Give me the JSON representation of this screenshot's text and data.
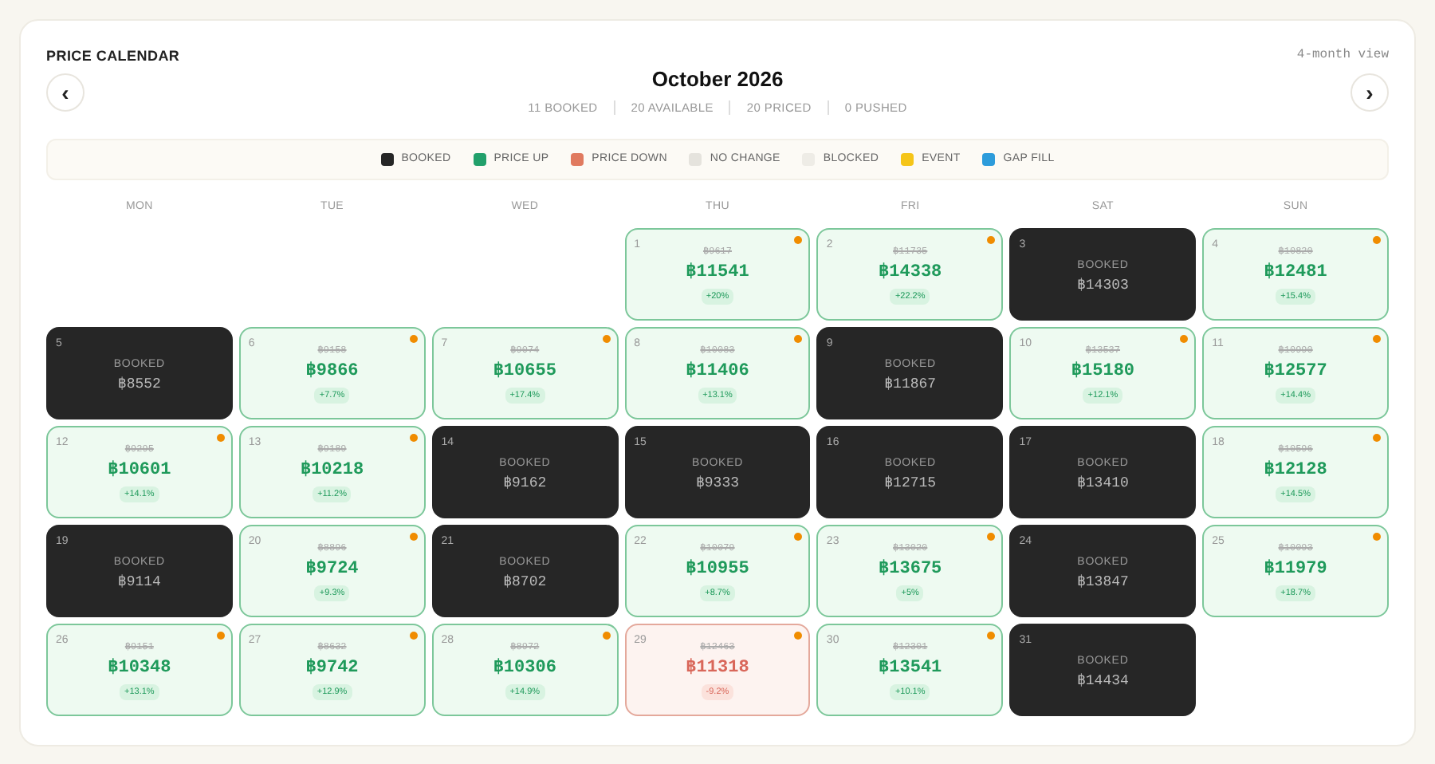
{
  "header": {
    "title": "PRICE CALENDAR",
    "view": "4-month view",
    "month": "October 2026",
    "prev_icon": "‹",
    "next_icon": "›"
  },
  "stats": [
    "11 BOOKED",
    "20 AVAILABLE",
    "20 PRICED",
    "0 PUSHED"
  ],
  "legend": [
    {
      "label": "BOOKED",
      "color": "#262626"
    },
    {
      "label": "PRICE UP",
      "color": "#22a06b"
    },
    {
      "label": "PRICE DOWN",
      "color": "#e07a5f"
    },
    {
      "label": "NO CHANGE",
      "color": "#e5e3dd"
    },
    {
      "label": "BLOCKED",
      "color": "#eeece6"
    },
    {
      "label": "EVENT",
      "color": "#f5c518"
    },
    {
      "label": "GAP FILL",
      "color": "#2d9cdb"
    }
  ],
  "weekdays": [
    "MON",
    "TUE",
    "WED",
    "THU",
    "FRI",
    "SAT",
    "SUN"
  ],
  "weeks": [
    [
      {
        "kind": "empty"
      },
      {
        "kind": "empty"
      },
      {
        "kind": "empty"
      },
      {
        "day": "1",
        "kind": "up",
        "old_price": "฿9617",
        "price": "฿11541",
        "change": "+20%",
        "flag": true
      },
      {
        "day": "2",
        "kind": "up",
        "old_price": "฿11735",
        "price": "฿14338",
        "change": "+22.2%",
        "flag": true
      },
      {
        "day": "3",
        "kind": "booked",
        "label": "BOOKED",
        "price": "฿14303"
      },
      {
        "day": "4",
        "kind": "up",
        "old_price": "฿10820",
        "price": "฿12481",
        "change": "+15.4%",
        "flag": true
      }
    ],
    [
      {
        "day": "5",
        "kind": "booked",
        "label": "BOOKED",
        "price": "฿8552"
      },
      {
        "day": "6",
        "kind": "up",
        "old_price": "฿9158",
        "price": "฿9866",
        "change": "+7.7%",
        "flag": true
      },
      {
        "day": "7",
        "kind": "up",
        "old_price": "฿9074",
        "price": "฿10655",
        "change": "+17.4%",
        "flag": true
      },
      {
        "day": "8",
        "kind": "up",
        "old_price": "฿10083",
        "price": "฿11406",
        "change": "+13.1%",
        "flag": true
      },
      {
        "day": "9",
        "kind": "booked",
        "label": "BOOKED",
        "price": "฿11867"
      },
      {
        "day": "10",
        "kind": "up",
        "old_price": "฿13537",
        "price": "฿15180",
        "change": "+12.1%",
        "flag": true
      },
      {
        "day": "11",
        "kind": "up",
        "old_price": "฿10990",
        "price": "฿12577",
        "change": "+14.4%",
        "flag": true
      }
    ],
    [
      {
        "day": "12",
        "kind": "up",
        "old_price": "฿9295",
        "price": "฿10601",
        "change": "+14.1%",
        "flag": true
      },
      {
        "day": "13",
        "kind": "up",
        "old_price": "฿9189",
        "price": "฿10218",
        "change": "+11.2%",
        "flag": true
      },
      {
        "day": "14",
        "kind": "booked",
        "label": "BOOKED",
        "price": "฿9162"
      },
      {
        "day": "15",
        "kind": "booked",
        "label": "BOOKED",
        "price": "฿9333"
      },
      {
        "day": "16",
        "kind": "booked",
        "label": "BOOKED",
        "price": "฿12715"
      },
      {
        "day": "17",
        "kind": "booked",
        "label": "BOOKED",
        "price": "฿13410"
      },
      {
        "day": "18",
        "kind": "up",
        "old_price": "฿10596",
        "price": "฿12128",
        "change": "+14.5%",
        "flag": true
      }
    ],
    [
      {
        "day": "19",
        "kind": "booked",
        "label": "BOOKED",
        "price": "฿9114"
      },
      {
        "day": "20",
        "kind": "up",
        "old_price": "฿8896",
        "price": "฿9724",
        "change": "+9.3%",
        "flag": true
      },
      {
        "day": "21",
        "kind": "booked",
        "label": "BOOKED",
        "price": "฿8702"
      },
      {
        "day": "22",
        "kind": "up",
        "old_price": "฿10079",
        "price": "฿10955",
        "change": "+8.7%",
        "flag": true
      },
      {
        "day": "23",
        "kind": "up",
        "old_price": "฿13020",
        "price": "฿13675",
        "change": "+5%",
        "flag": true
      },
      {
        "day": "24",
        "kind": "booked",
        "label": "BOOKED",
        "price": "฿13847"
      },
      {
        "day": "25",
        "kind": "up",
        "old_price": "฿10093",
        "price": "฿11979",
        "change": "+18.7%",
        "flag": true
      }
    ],
    [
      {
        "day": "26",
        "kind": "up",
        "old_price": "฿9151",
        "price": "฿10348",
        "change": "+13.1%",
        "flag": true
      },
      {
        "day": "27",
        "kind": "up",
        "old_price": "฿8632",
        "price": "฿9742",
        "change": "+12.9%",
        "flag": true
      },
      {
        "day": "28",
        "kind": "up",
        "old_price": "฿8972",
        "price": "฿10306",
        "change": "+14.9%",
        "flag": true
      },
      {
        "day": "29",
        "kind": "down",
        "old_price": "฿12463",
        "price": "฿11318",
        "change": "-9.2%",
        "flag": true
      },
      {
        "day": "30",
        "kind": "up",
        "old_price": "฿12301",
        "price": "฿13541",
        "change": "+10.1%",
        "flag": true
      },
      {
        "day": "31",
        "kind": "booked",
        "label": "BOOKED",
        "price": "฿14434"
      },
      {
        "kind": "empty"
      }
    ]
  ]
}
